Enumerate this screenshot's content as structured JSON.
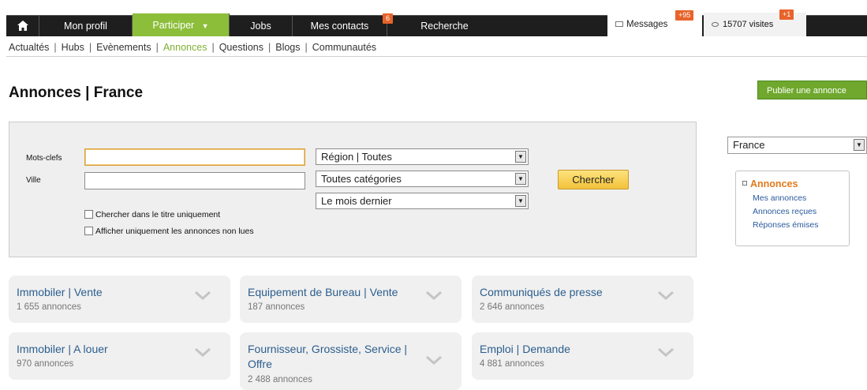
{
  "nav": {
    "home_icon": "home-icon",
    "items": [
      {
        "label": "Mon profil"
      },
      {
        "label": "Participer"
      },
      {
        "label": "Jobs"
      },
      {
        "label": "Mes contacts"
      },
      {
        "label": "Recherche"
      }
    ],
    "contacts_badge": "6",
    "messages_label": "Messages",
    "messages_badge": "+95",
    "visits_label": "15707 visites",
    "visits_badge": "+1"
  },
  "subnav": [
    "Actualtés",
    "Hubs",
    "Evènements",
    "Annonces",
    "Questions",
    "Blogs",
    "Communautés"
  ],
  "subnav_active": "Annonces",
  "page": {
    "title": "Annonces | France",
    "publish_button": "Publier une annonce"
  },
  "search": {
    "keywords_label": "Mots-clefs",
    "keywords_value": "",
    "city_label": "Ville",
    "city_value": "",
    "region_select": "Région | Toutes",
    "category_select": "Toutes catégories",
    "period_select": "Le mois dernier",
    "search_button": "Chercher",
    "checkbox_title_only": "Chercher dans le titre uniquement",
    "checkbox_unread_only": "Afficher uniquement les annonces non lues"
  },
  "sidebar": {
    "country_select": "France",
    "box_title": "Annonces",
    "links": [
      "Mes annonces",
      "Annonces reçues",
      "Réponses émises"
    ]
  },
  "categories": [
    {
      "name": "Immobiler | Vente",
      "count": "1 655 annonces"
    },
    {
      "name": "Equipement de Bureau | Vente",
      "count": "187 annonces"
    },
    {
      "name": "Communiqués de presse",
      "count": "2 646 annonces"
    },
    {
      "name": "Immobiler | A louer",
      "count": "970 annonces"
    },
    {
      "name": "Fournisseur, Grossiste, Service | Offre",
      "count": "2 488 annonces"
    },
    {
      "name": "Emploi | Demande",
      "count": "4 881 annonces"
    }
  ],
  "colors": {
    "nav_bg": "#1e1e1e",
    "accent_green": "#8cbe3a",
    "badge_orange": "#e8632b",
    "link_blue": "#2b5e8e",
    "search_button": "#f2c13a"
  }
}
